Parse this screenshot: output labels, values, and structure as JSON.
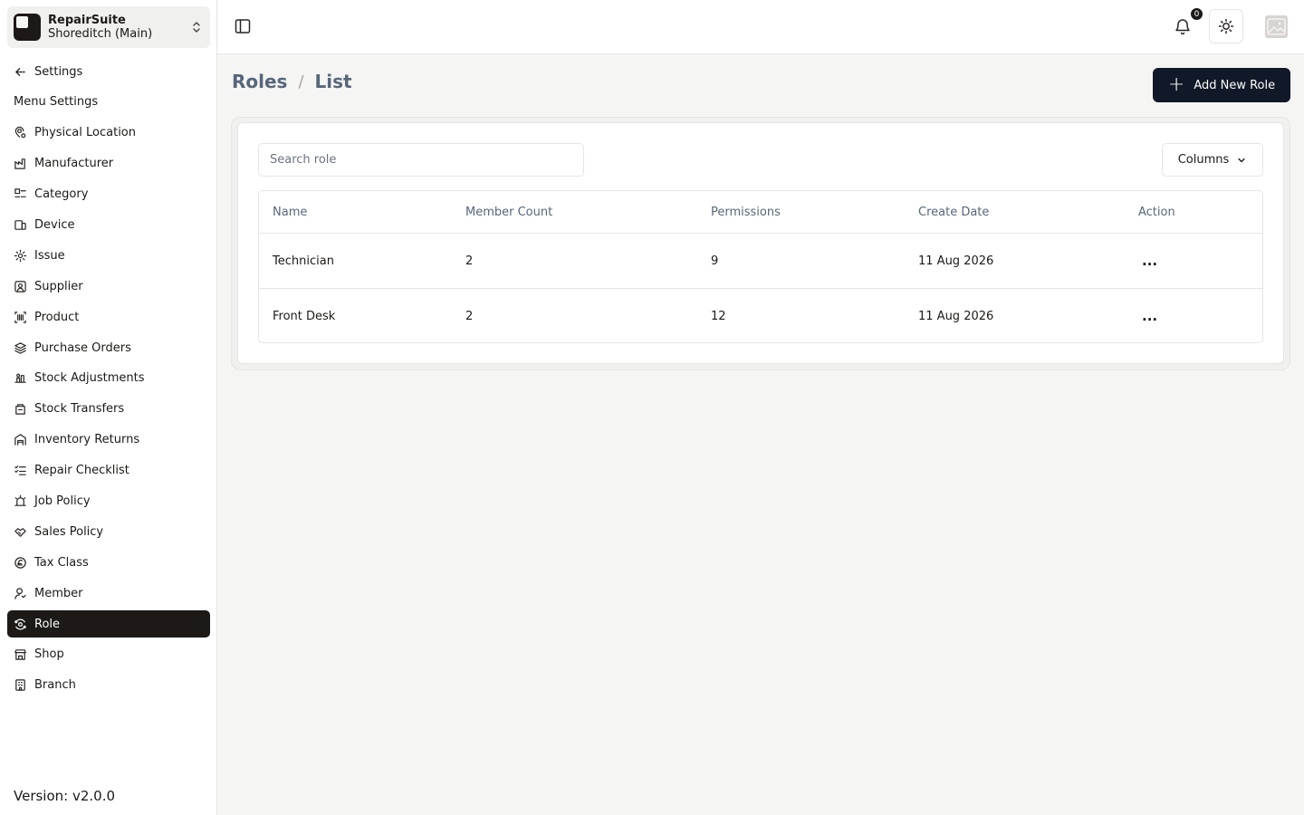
{
  "workspace": {
    "name": "RepairSuite",
    "branch": "Shoreditch (Main)"
  },
  "sidebar": {
    "back_label": "Settings",
    "section_label": "Menu Settings",
    "items": [
      {
        "label": "Physical Location",
        "icon": "location-icon"
      },
      {
        "label": "Manufacturer",
        "icon": "factory-icon"
      },
      {
        "label": "Category",
        "icon": "category-icon"
      },
      {
        "label": "Device",
        "icon": "device-icon"
      },
      {
        "label": "Issue",
        "icon": "cog-icon"
      },
      {
        "label": "Supplier",
        "icon": "supplier-icon"
      },
      {
        "label": "Product",
        "icon": "barcode-icon"
      },
      {
        "label": "Purchase Orders",
        "icon": "layers-icon"
      },
      {
        "label": "Stock Adjustments",
        "icon": "adjust-icon"
      },
      {
        "label": "Stock Transfers",
        "icon": "transfer-icon"
      },
      {
        "label": "Inventory Returns",
        "icon": "warehouse-icon"
      },
      {
        "label": "Repair Checklist",
        "icon": "checklist-icon"
      },
      {
        "label": "Job Policy",
        "icon": "alarm-icon"
      },
      {
        "label": "Sales Policy",
        "icon": "handshake-icon"
      },
      {
        "label": "Tax Class",
        "icon": "currency-icon"
      },
      {
        "label": "Member",
        "icon": "user-icon"
      },
      {
        "label": "Role",
        "icon": "role-icon",
        "active": true
      },
      {
        "label": "Shop",
        "icon": "store-icon"
      },
      {
        "label": "Branch",
        "icon": "building-icon"
      }
    ],
    "version": "Version: v2.0.0"
  },
  "topbar": {
    "notification_count": "0"
  },
  "page": {
    "breadcrumb": [
      "Roles",
      "List"
    ],
    "add_button": "Add New Role",
    "search_placeholder": "Search role",
    "columns_button": "Columns"
  },
  "table": {
    "headers": [
      "Name",
      "Member Count",
      "Permissions",
      "Create Date",
      "Action"
    ],
    "rows": [
      {
        "name": "Technician",
        "member_count": "2",
        "permissions": "9",
        "create_date": "11 Aug 2026",
        "action": "..."
      },
      {
        "name": "Front Desk",
        "member_count": "2",
        "permissions": "12",
        "create_date": "11 Aug 2026",
        "action": "..."
      }
    ]
  },
  "colors": {
    "active_nav": "#1c1917",
    "primary_button": "#111827",
    "breadcrumb": "#57667a"
  }
}
